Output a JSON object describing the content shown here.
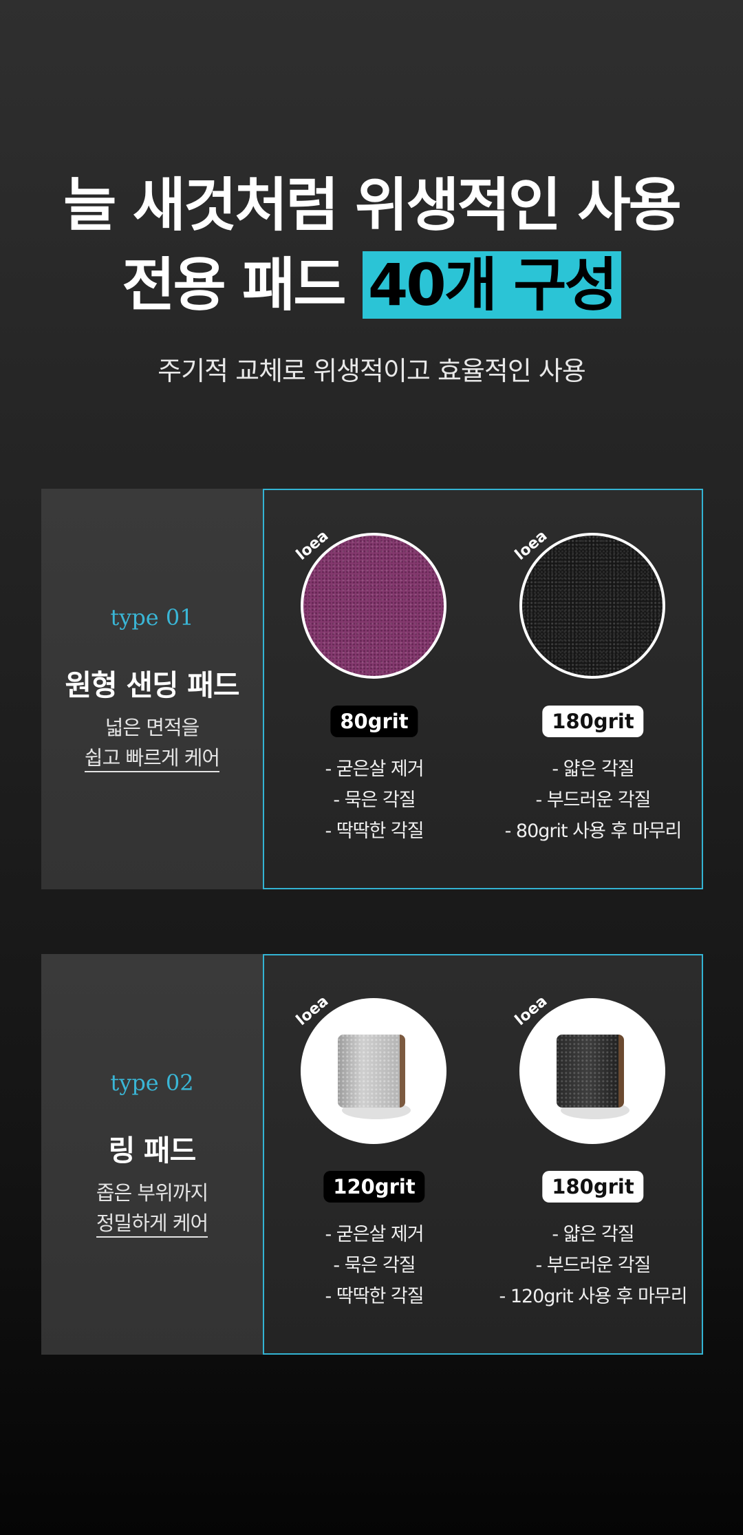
{
  "hero": {
    "title_line1": "늘 새것처럼 위생적인 사용",
    "title_line2_prefix": "전용 패드",
    "title_line2_highlight": "40개 구성",
    "subtitle": "주기적 교체로 위생적이고 효율적인 사용"
  },
  "colors": {
    "accent": "#2bc4d6",
    "type_label": "#3ab6d6",
    "panel_border": "#33b4d4"
  },
  "sections": [
    {
      "type_label": "type 01",
      "title": "원형 샌딩 패드",
      "desc_line1": "넓은 면적을",
      "desc_line2": "쉽고 빠르게 케어",
      "products": [
        {
          "brand": "loea",
          "image": "purple-sanding-disc",
          "grit": "80grit",
          "features": [
            "- 굳은살 제거",
            "- 묵은 각질",
            "- 딱딱한 각질"
          ]
        },
        {
          "brand": "loea",
          "image": "black-sanding-disc",
          "grit": "180grit",
          "features": [
            "- 얇은 각질",
            "- 부드러운 각질",
            "- 80grit 사용 후 마무리"
          ]
        }
      ]
    },
    {
      "type_label": "type 02",
      "title": "링 패드",
      "desc_line1": "좁은 부위까지",
      "desc_line2": "정밀하게 케어",
      "products": [
        {
          "brand": "loea",
          "image": "grey-ring-pad",
          "grit": "120grit",
          "features": [
            "- 굳은살 제거",
            "- 묵은 각질",
            "- 딱딱한 각질"
          ]
        },
        {
          "brand": "loea",
          "image": "black-ring-pad",
          "grit": "180grit",
          "features": [
            "- 얇은 각질",
            "- 부드러운 각질",
            "- 120grit 사용 후 마무리"
          ]
        }
      ]
    }
  ]
}
